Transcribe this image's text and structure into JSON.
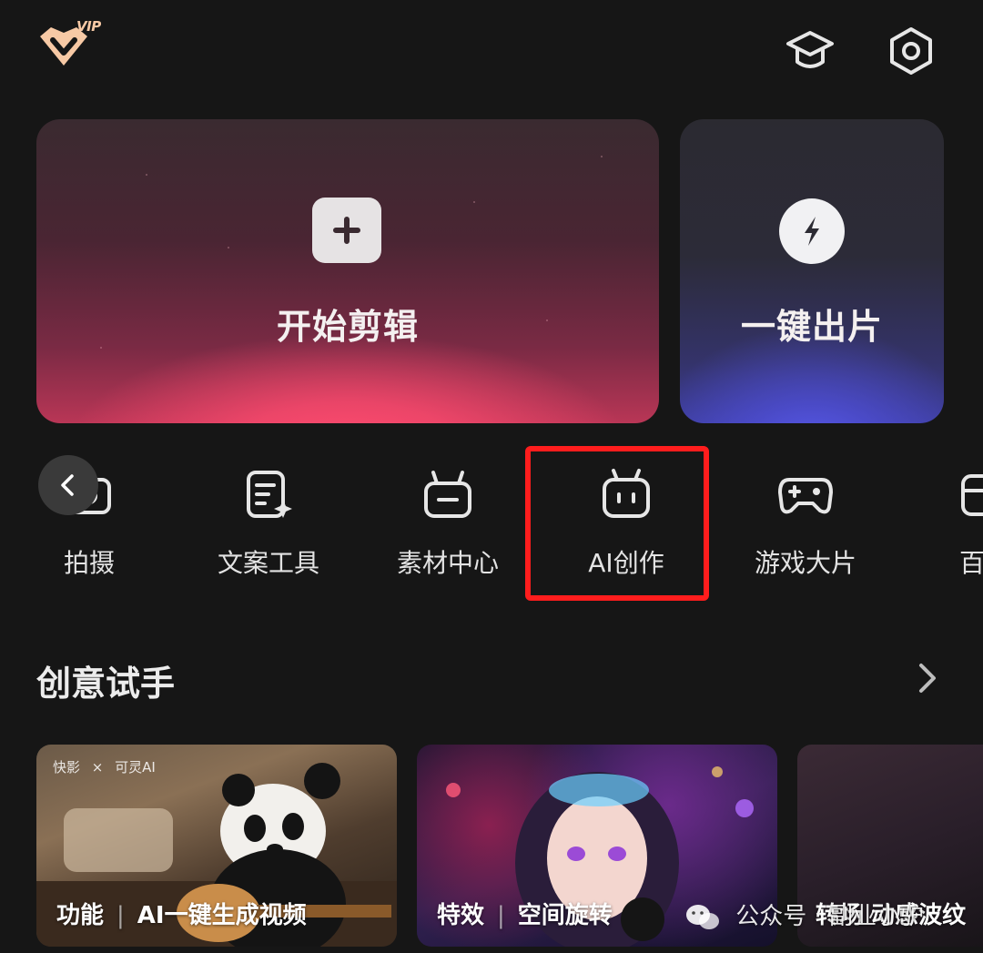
{
  "header": {
    "vip_badge": "VIP",
    "icons": [
      "tutorial-graduation-cap-icon",
      "settings-hexagon-icon"
    ]
  },
  "hero": {
    "start_edit": {
      "label": "开始剪辑",
      "icon": "plus-icon"
    },
    "one_click": {
      "label": "一键出片",
      "icon": "lightning-bolt-icon"
    }
  },
  "tools": [
    {
      "label": "拍摄",
      "icon": "camera-icon"
    },
    {
      "label": "文案工具",
      "icon": "document-sparkle-icon"
    },
    {
      "label": "素材中心",
      "icon": "material-box-icon"
    },
    {
      "label": "AI创作",
      "icon": "robot-icon"
    },
    {
      "label": "游戏大片",
      "icon": "gamepad-icon"
    },
    {
      "label": "百宝",
      "icon": "toolbox-icon"
    }
  ],
  "highlight": {
    "target": "AI创作",
    "color": "#ff1d1d"
  },
  "section": {
    "title": "创意试手",
    "arrow": "chevron-right-icon"
  },
  "thumbnails": [
    {
      "tag": "功能",
      "title": "AI一键生成视频",
      "brand_left": "快影",
      "brand_right": "可灵AI"
    },
    {
      "tag": "特效",
      "title": "空间旋转"
    },
    {
      "tag": "转场",
      "title": "动感波纹"
    }
  ],
  "watermark": {
    "text": "公众号 · 副业小驴"
  },
  "colors": {
    "background": "#161616",
    "hero_pink": "#ff4b6f",
    "hero_blue": "#5a5cf0",
    "vip_gold": "#f7c9a5"
  }
}
